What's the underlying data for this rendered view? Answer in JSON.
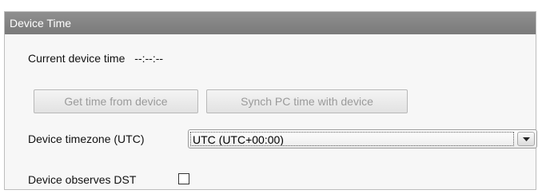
{
  "panel": {
    "title": "Device Time"
  },
  "current_time": {
    "label": "Current device time",
    "value": "--:--:--"
  },
  "buttons": {
    "get_time": "Get time from device",
    "sync_time": "Synch PC time with device"
  },
  "timezone": {
    "label": "Device timezone (UTC)",
    "selected": "UTC (UTC+00:00)"
  },
  "dst": {
    "label": "Device observes DST",
    "checked": false
  },
  "icons": {
    "dropdown": "chevron-down-icon",
    "checkbox": "checkbox-unchecked"
  },
  "colors": {
    "header_bg": "#828282",
    "panel_bg": "#f7f7f7",
    "disabled_text": "#9a9a9a"
  }
}
